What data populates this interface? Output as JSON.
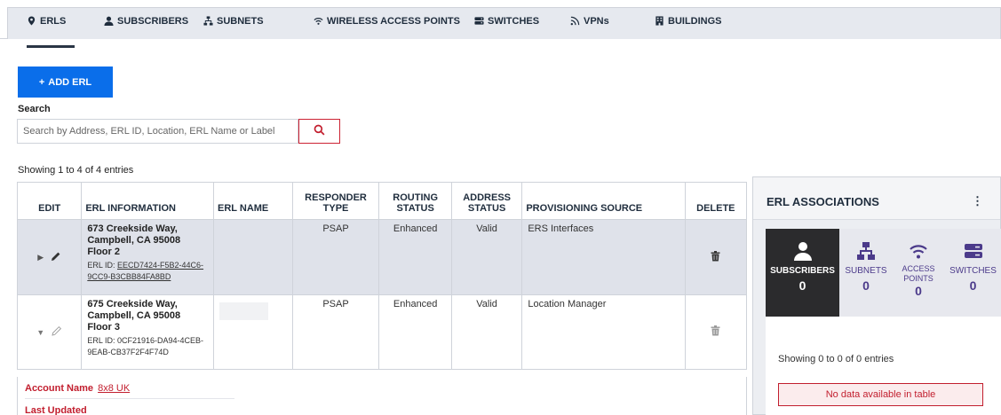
{
  "tabs": [
    {
      "label": "ERLS",
      "icon": "location-pin-icon",
      "active": true
    },
    {
      "label": "SUBSCRIBERS",
      "icon": "person-icon",
      "active": false
    },
    {
      "label": "SUBNETS",
      "icon": "network-icon",
      "active": false
    },
    {
      "label": "WIRELESS ACCESS POINTS",
      "icon": "wifi-icon",
      "active": false
    },
    {
      "label": "SWITCHES",
      "icon": "switch-icon",
      "active": false
    },
    {
      "label": "VPNs",
      "icon": "rss-icon",
      "active": false
    },
    {
      "label": "BUILDINGS",
      "icon": "building-icon",
      "active": false
    }
  ],
  "actions": {
    "add_label": "ADD ERL",
    "add_icon": "plus-icon"
  },
  "search": {
    "label": "Search",
    "placeholder": "Search by Address, ERL ID, Location, ERL Name or Label",
    "value": ""
  },
  "table": {
    "showing": "Showing 1 to 4 of 4 entries",
    "headers": {
      "edit": "EDIT",
      "erl_info": "ERL INFORMATION",
      "erl_name": "ERL NAME",
      "responder": "RESPONDER TYPE",
      "routing": "ROUTING STATUS",
      "address": "ADDRESS STATUS",
      "provisioning": "PROVISIONING SOURCE",
      "delete": "DELETE"
    },
    "rows": [
      {
        "addr1": "673 Creekside Way,",
        "addr2": "Campbell, CA 95008",
        "addr3": "Floor 2",
        "erl_id_prefix": "ERL ID: ",
        "erl_id": "EECD7424-F5B2-44C6-9CC9-B3CBB84FA8BD",
        "erl_name": "",
        "responder": "PSAP",
        "routing": "Enhanced",
        "address": "Valid",
        "provisioning": "ERS Interfaces",
        "expander": "▶",
        "selected": true
      },
      {
        "addr1": "675 Creekside Way,",
        "addr2": "Campbell, CA 95008",
        "addr3": "Floor 3",
        "erl_id_prefix": "ERL ID: ",
        "erl_id": "0CF21916-DA94-4CEB-9EAB-CB37F2F4F74D",
        "erl_name": "",
        "responder": "PSAP",
        "routing": "Enhanced",
        "address": "Valid",
        "provisioning": "Location Manager",
        "expander": "▼",
        "selected": false
      }
    ],
    "detail": {
      "account_label": "Account Name",
      "account_value": "8x8 UK",
      "last_updated_label": "Last Updated"
    }
  },
  "associations": {
    "title": "ERL ASSOCIATIONS",
    "menu": "⋮",
    "tiles": [
      {
        "label": "SUBSCRIBERS",
        "count": "0",
        "icon": "person-icon",
        "active": true
      },
      {
        "label": "SUBNETS",
        "count": "0",
        "icon": "network-icon",
        "active": false
      },
      {
        "label": "ACCESS POINTS",
        "count": "0",
        "icon": "wifi-icon",
        "active": false
      },
      {
        "label": "SWITCHES",
        "count": "0",
        "icon": "switch-icon",
        "active": false
      }
    ],
    "showing": "Showing 0 to 0 of 0 entries",
    "empty": "No data available in table"
  },
  "colors": {
    "primary": "#0a6eea",
    "danger": "#c21e2e",
    "accent_purple": "#4b3a8a",
    "tab_bg": "#e6e9ef",
    "selected_row": "#dfe2ea"
  }
}
